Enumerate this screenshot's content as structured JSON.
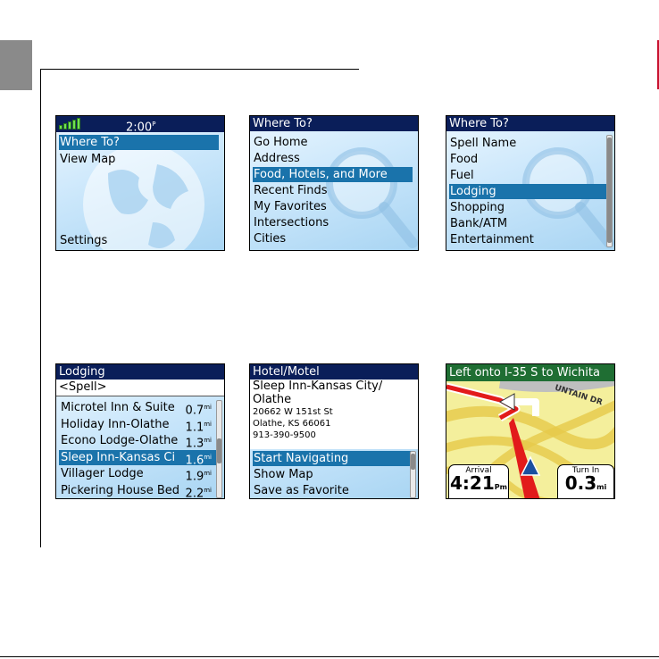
{
  "screen1": {
    "time": "2:00",
    "time_suffix": "P",
    "items": [
      {
        "label": "Where To?",
        "selected": true
      },
      {
        "label": "View Map",
        "selected": false
      },
      {
        "label": "Settings",
        "selected": false
      }
    ]
  },
  "screen2": {
    "title": "Where To?",
    "items": [
      {
        "label": "Go Home"
      },
      {
        "label": "Address"
      },
      {
        "label": "Food, Hotels, and More"
      },
      {
        "label": "Recent Finds"
      },
      {
        "label": "My Favorites"
      },
      {
        "label": "Intersections"
      },
      {
        "label": "Cities"
      }
    ],
    "selected_index": 2
  },
  "screen3": {
    "title": "Where To?",
    "items": [
      {
        "label": "Spell Name"
      },
      {
        "label": "Food"
      },
      {
        "label": "Fuel"
      },
      {
        "label": "Lodging"
      },
      {
        "label": "Shopping"
      },
      {
        "label": "Bank/ATM"
      },
      {
        "label": "Entertainment"
      }
    ],
    "selected_index": 3
  },
  "screen4": {
    "title": "Lodging",
    "spell": "<Spell>",
    "items": [
      {
        "name": "Microtel Inn & Suite",
        "distance": "0.7",
        "unit": "mi"
      },
      {
        "name": "Holiday Inn-Olathe",
        "distance": "1.1",
        "unit": "mi"
      },
      {
        "name": "Econo Lodge-Olathe",
        "distance": "1.3",
        "unit": "mi"
      },
      {
        "name": "Sleep Inn-Kansas Ci",
        "distance": "1.6",
        "unit": "mi"
      },
      {
        "name": "Villager Lodge",
        "distance": "1.9",
        "unit": "mi"
      },
      {
        "name": "Pickering House Bed",
        "distance": "2.2",
        "unit": "mi"
      }
    ],
    "selected_index": 3
  },
  "screen5": {
    "title": "Hotel/Motel",
    "name_line1": "Sleep Inn-Kansas City/",
    "name_line2": "Olathe",
    "address1": "20662 W 151st St",
    "address2": "Olathe, KS 66061",
    "phone": "913-390-9500",
    "actions": [
      {
        "label": "Start Navigating"
      },
      {
        "label": "Show Map"
      },
      {
        "label": "Save as Favorite"
      }
    ],
    "selected_index": 0
  },
  "screen6": {
    "banner": "Left onto I-35 S to Wichita",
    "street_label": "UNTAIN DR",
    "arrival_label": "Arrival",
    "arrival_value": "4:21",
    "arrival_unit_top": "P",
    "arrival_unit_bottom": "m",
    "turn_label": "Turn In",
    "turn_value": "0.3",
    "turn_unit_top": "m",
    "turn_unit_bottom": "i"
  },
  "colors": {
    "title_bar": "#0a1e59",
    "selection": "#1a73ab",
    "banner": "#1f6e33",
    "route": "#e21b1b"
  }
}
